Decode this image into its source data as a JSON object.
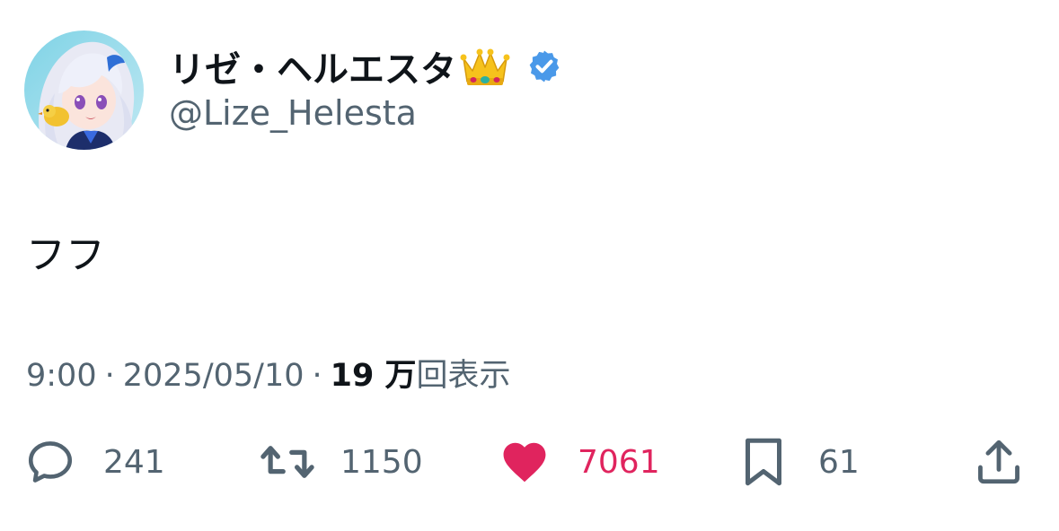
{
  "author": {
    "display_name": "リゼ・ヘルエスタ",
    "handle": "@Lize_Helesta",
    "name_emoji_icon": "crown-emoji-icon",
    "verified_icon": "verified-badge-icon",
    "verified_color": "#4a99e9"
  },
  "tweet": {
    "text": "フフ"
  },
  "meta": {
    "time": "9:00",
    "separator": "·",
    "date": "2025/05/10",
    "views_count": "19 万",
    "views_label": "回表示"
  },
  "actions": {
    "reply": {
      "icon": "reply-bubble-icon",
      "count": "241"
    },
    "retweet": {
      "icon": "retweet-icon",
      "count": "1150"
    },
    "like": {
      "icon": "heart-icon",
      "count": "7061",
      "active": true,
      "color": "#e0245e"
    },
    "bookmark": {
      "icon": "bookmark-icon",
      "count": "61"
    },
    "share": {
      "icon": "share-icon"
    }
  },
  "colors": {
    "text_primary": "#0f1419",
    "text_secondary": "#536471",
    "like_active": "#e0245e",
    "background": "#ffffff"
  }
}
